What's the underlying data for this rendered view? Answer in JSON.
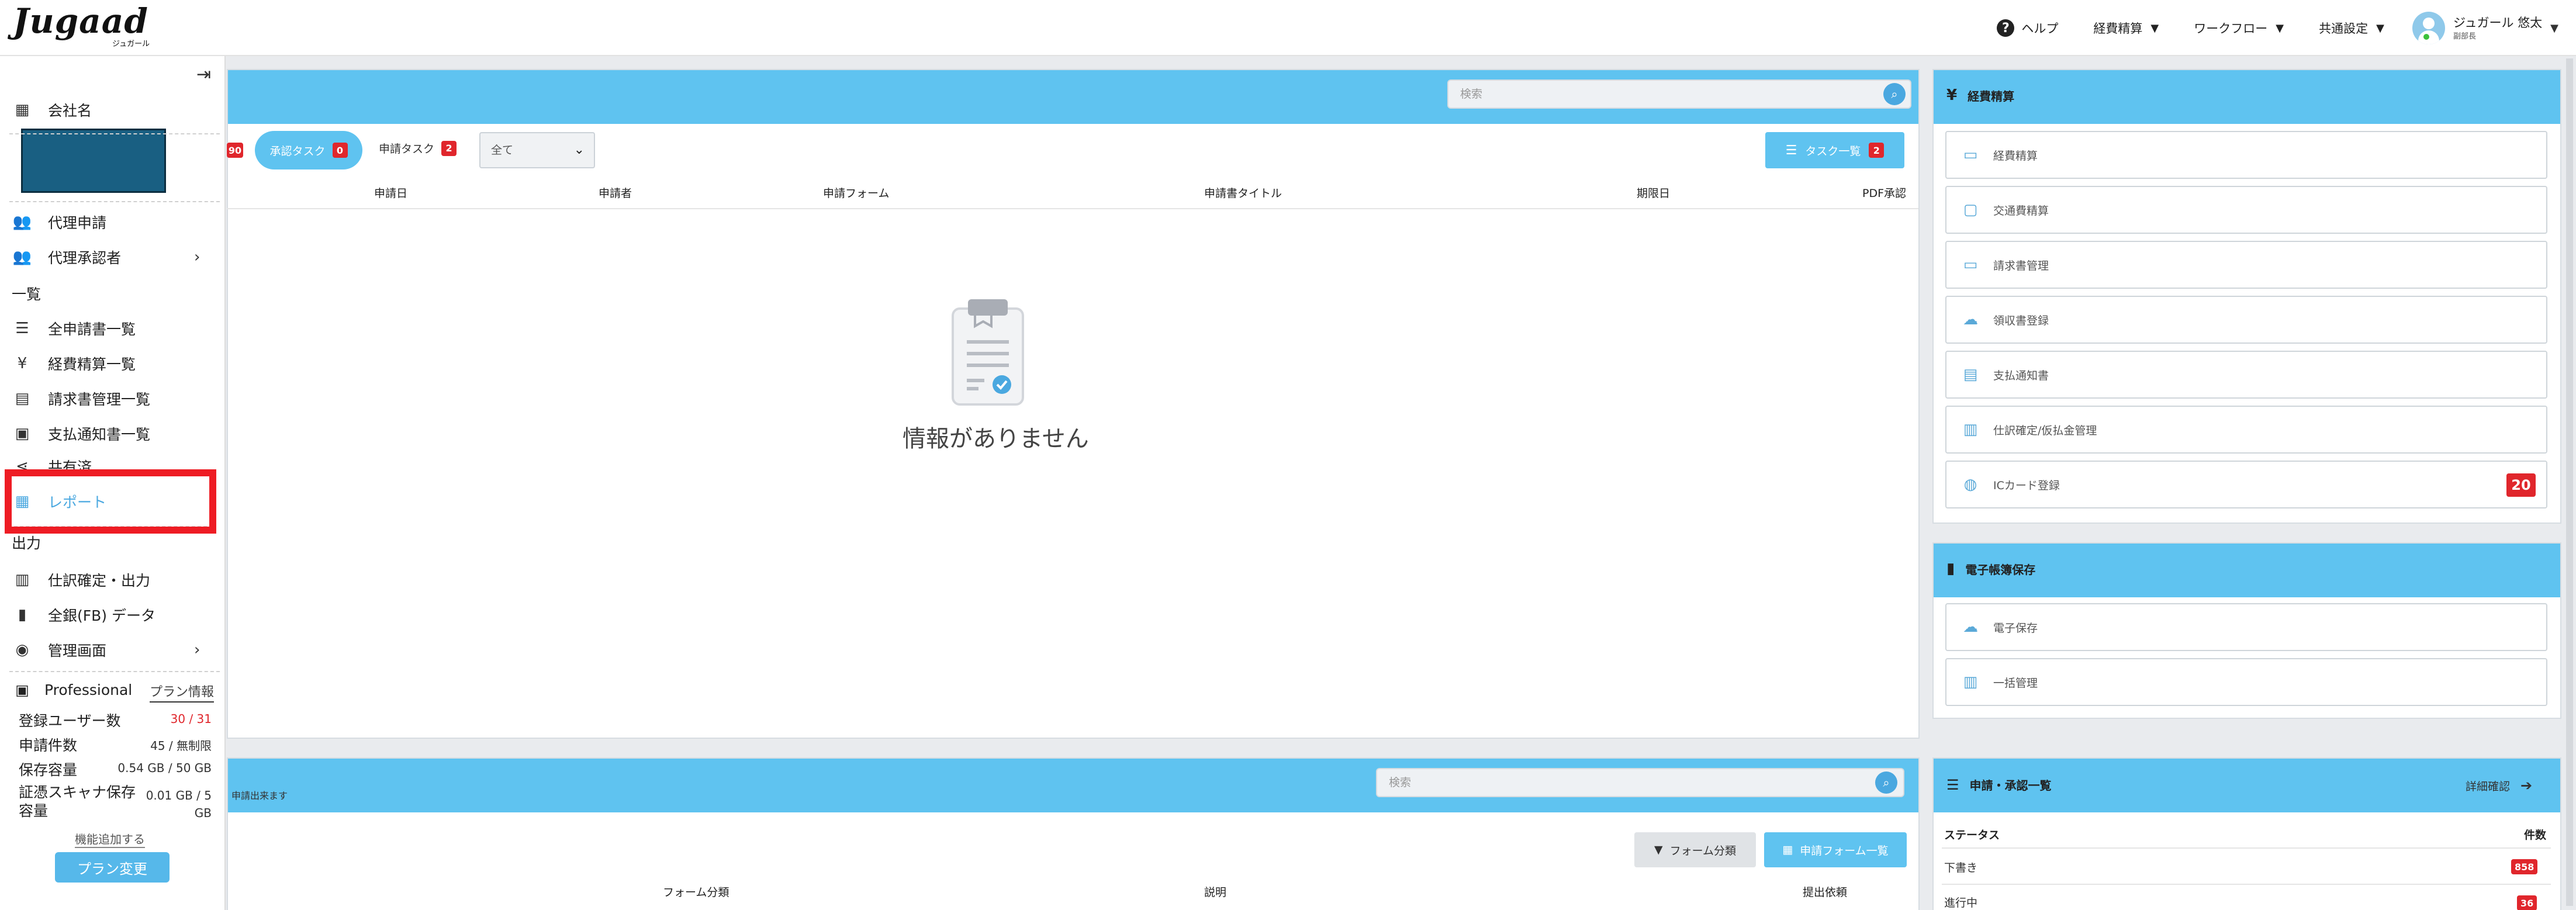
{
  "header": {
    "logo_text": "Jugaad",
    "logo_kana": "ジュガール",
    "help_label": "ヘルプ",
    "nav": [
      "経費精算",
      "ワークフロー",
      "共通設定"
    ],
    "user_name": "ジュガール 悠太",
    "user_role": "副部長"
  },
  "sidebar": {
    "company_label": "会社名",
    "proxy_apply": "代理申請",
    "proxy_approver": "代理承認者",
    "list_section": "一覧",
    "items": [
      "全申請書一覧",
      "経費精算一覧",
      "請求書管理一覧",
      "支払通知書一覧",
      "共有済",
      "レポート"
    ],
    "output_section": "出力",
    "output_items": [
      "仕訳確定・出力",
      "全銀(FB) データ"
    ],
    "admin": "管理画面",
    "plan_name": "Professional",
    "plan_info": "プラン情報",
    "stats": [
      {
        "label": "登録ユーザー数",
        "value": "30 / 31"
      },
      {
        "label": "申請件数",
        "value": "45 / 無制限"
      },
      {
        "label": "保存容量",
        "value": "0.54 GB / 50 GB"
      },
      {
        "label": "証憑スキャナ保存容量",
        "value": "0.01 GB / 5 GB"
      }
    ],
    "add_feature": "機能追加する",
    "plan_change": "プラン変更"
  },
  "tasks": {
    "search_placeholder": "検索",
    "left_badge": "90",
    "approve_tab": "承認タスク",
    "approve_count": "0",
    "apply_tab": "申請タスク",
    "apply_count": "2",
    "filter_value": "全て",
    "task_list_label": "タスク一覧",
    "task_list_count": "2",
    "columns": [
      "申請日",
      "申請者",
      "申請フォーム",
      "申請書タイトル",
      "期限日",
      "PDF承認"
    ],
    "empty": "情報がありません"
  },
  "forms": {
    "subtitle": "申請出来ます",
    "search_placeholder": "検索",
    "filter_label": "フォーム分類",
    "list_label": "申請フォーム一覧",
    "columns": [
      "フォーム分類",
      "説明",
      "提出依頼"
    ]
  },
  "expense_card": {
    "title": "経費精算",
    "items": [
      {
        "label": "経費精算",
        "icon": "money-icon"
      },
      {
        "label": "交通費精算",
        "icon": "train-icon"
      },
      {
        "label": "請求書管理",
        "icon": "card-icon"
      },
      {
        "label": "領収書登録",
        "icon": "cloud-upload-icon"
      },
      {
        "label": "支払通知書",
        "icon": "receipt-icon"
      },
      {
        "label": "仕訳確定/仮払金管理",
        "icon": "journal-icon"
      },
      {
        "label": "ICカード登録",
        "icon": "globe-icon",
        "count": "20"
      }
    ]
  },
  "ebook_card": {
    "title": "電子帳簿保存",
    "items": [
      "電子保存",
      "一括管理"
    ]
  },
  "approval_card": {
    "title": "申請・承認一覧",
    "detail": "詳細確認",
    "status_col": "ステータス",
    "count_col": "件数",
    "rows": [
      {
        "status": "下書き",
        "count": "858"
      },
      {
        "status": "進行中",
        "count": "36"
      }
    ]
  },
  "colors": {
    "accent": "#5fc3f0",
    "badge": "#e0262c",
    "highlight": "#ee1c24",
    "company_box": "#195f82"
  }
}
